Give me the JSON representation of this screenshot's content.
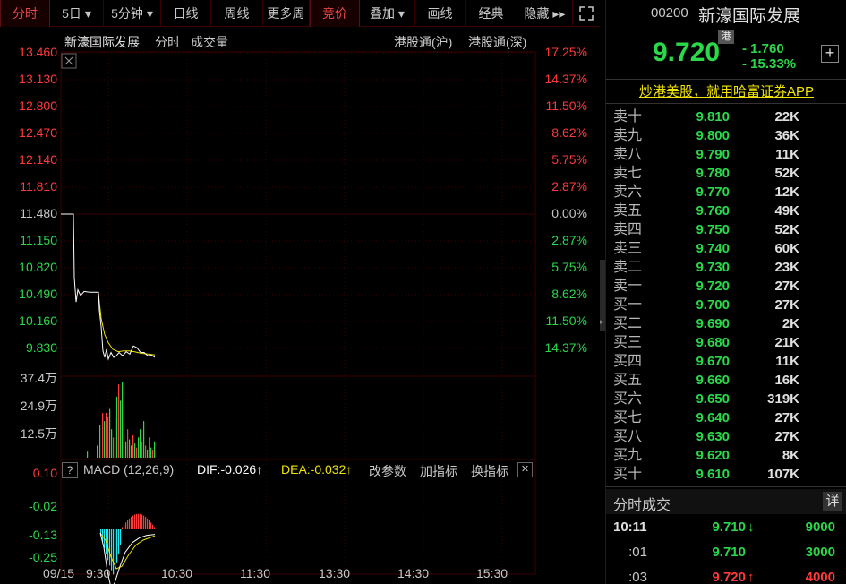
{
  "toolbar": {
    "tabs": [
      {
        "label": "分时",
        "active": true
      },
      {
        "label": "5日 ▾"
      },
      {
        "label": "5分钟 ▾"
      },
      {
        "label": "日线"
      },
      {
        "label": "周线"
      },
      {
        "label": "更多周"
      },
      {
        "label": "竞价",
        "active": true
      },
      {
        "label": "叠加 ▾"
      },
      {
        "label": "画线"
      },
      {
        "label": "经典"
      },
      {
        "label": "隐藏 ▸▸"
      }
    ],
    "expand_icon": "expand-icon"
  },
  "chart_header": {
    "name": "新濠国际发展",
    "mode": "分时",
    "volume": "成交量",
    "connect_sh": "港股通(沪)",
    "connect_sz": "港股通(深)"
  },
  "price_axis": {
    "left": [
      "13.460",
      "13.130",
      "12.800",
      "12.470",
      "12.140",
      "11.810",
      "11.480",
      "11.150",
      "10.820",
      "10.490",
      "10.160",
      "9.830"
    ],
    "right": [
      "17.25%",
      "14.37%",
      "11.50%",
      "8.62%",
      "5.75%",
      "2.87%",
      "0.00%",
      "2.87%",
      "5.75%",
      "8.62%",
      "11.50%",
      "14.37%"
    ]
  },
  "volume_axis": [
    "37.4万",
    "24.9万",
    "12.5万"
  ],
  "macd": {
    "help": "?",
    "title": "MACD (12,26,9)",
    "dif": "DIF:-0.026↑",
    "dea": "DEA:-0.032↑",
    "change_params": "改参数",
    "add_indicator": "加指标",
    "swap_indicator": "换指标",
    "close": "✕",
    "axis": [
      "0.10",
      "-0.02",
      "-0.13",
      "-0.25"
    ]
  },
  "time_axis": [
    "09/15",
    "9:30",
    "10:30",
    "11:30",
    "13:30",
    "14:30",
    "15:30"
  ],
  "quote": {
    "code": "00200",
    "name": "新濠国际发展",
    "market_tag": "港",
    "price": "9.720",
    "change": "- 1.760",
    "change_pct": "- 15.33%",
    "add_icon": "plus-icon"
  },
  "banner": "炒港美股，就用哈富证券APP",
  "order_book": {
    "sells": [
      {
        "label": "卖十",
        "price": "9.810",
        "vol": "22K"
      },
      {
        "label": "卖九",
        "price": "9.800",
        "vol": "36K"
      },
      {
        "label": "卖八",
        "price": "9.790",
        "vol": "11K"
      },
      {
        "label": "卖七",
        "price": "9.780",
        "vol": "52K"
      },
      {
        "label": "卖六",
        "price": "9.770",
        "vol": "12K"
      },
      {
        "label": "卖五",
        "price": "9.760",
        "vol": "49K"
      },
      {
        "label": "卖四",
        "price": "9.750",
        "vol": "52K"
      },
      {
        "label": "卖三",
        "price": "9.740",
        "vol": "60K"
      },
      {
        "label": "卖二",
        "price": "9.730",
        "vol": "23K"
      },
      {
        "label": "卖一",
        "price": "9.720",
        "vol": "27K"
      }
    ],
    "buys": [
      {
        "label": "买一",
        "price": "9.700",
        "vol": "27K"
      },
      {
        "label": "买二",
        "price": "9.690",
        "vol": "2K"
      },
      {
        "label": "买三",
        "price": "9.680",
        "vol": "21K"
      },
      {
        "label": "买四",
        "price": "9.670",
        "vol": "11K"
      },
      {
        "label": "买五",
        "price": "9.660",
        "vol": "16K"
      },
      {
        "label": "买六",
        "price": "9.650",
        "vol": "319K"
      },
      {
        "label": "买七",
        "price": "9.640",
        "vol": "27K"
      },
      {
        "label": "买八",
        "price": "9.630",
        "vol": "27K"
      },
      {
        "label": "买九",
        "price": "9.620",
        "vol": "8K"
      },
      {
        "label": "买十",
        "price": "9.610",
        "vol": "107K"
      }
    ]
  },
  "trades": {
    "title": "分时成交",
    "detail": "详",
    "rows": [
      {
        "time": "10:11",
        "price": "9.710",
        "arrow": "↓",
        "vol": "9000",
        "dir": "down"
      },
      {
        "time": ":01",
        "price": "9.710",
        "arrow": "",
        "vol": "3000",
        "dir": "flat"
      },
      {
        "time": ":03",
        "price": "9.720",
        "arrow": "↑",
        "vol": "4000",
        "dir": "up"
      }
    ]
  },
  "colors": {
    "up": "#ff3a3a",
    "down": "#2ad84a",
    "grid": "#3a0000",
    "avg_line": "#f0e400",
    "price_line": "#ffffff"
  }
}
